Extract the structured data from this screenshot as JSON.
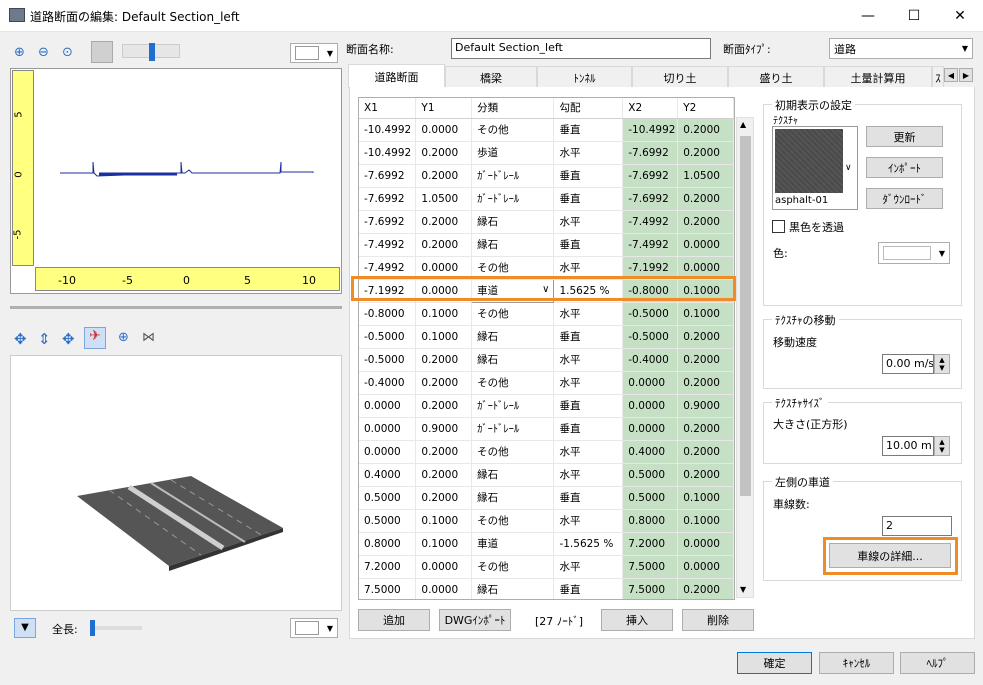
{
  "window": {
    "title": "道路断面の編集: Default Section_left",
    "minimize": "—",
    "maximize": "☐",
    "close": "✕"
  },
  "left": {
    "ruler_y_labels": [
      "5",
      "0",
      "-5"
    ],
    "ruler_x_labels": [
      "-10",
      "-5",
      "0",
      "5",
      "10"
    ],
    "length_label": "全長:"
  },
  "header": {
    "name_label": "断面名称:",
    "name_value": "Default Section_left",
    "type_label": "断面ﾀｲﾌﾟ:",
    "type_value": "道路"
  },
  "tabs": [
    "道路断面",
    "橋梁",
    "ﾄﾝﾈﾙ",
    "切り土",
    "盛り土",
    "土量計算用",
    "ｽ"
  ],
  "grid": {
    "columns": [
      "X1",
      "Y1",
      "分類",
      "勾配",
      "X2",
      "Y2"
    ],
    "rows": [
      [
        "-10.4992",
        "0.0000",
        "その他",
        "垂直",
        "-10.4992",
        "0.2000"
      ],
      [
        "-10.4992",
        "0.2000",
        "歩道",
        "水平",
        "-7.6992",
        "0.2000"
      ],
      [
        "-7.6992",
        "0.2000",
        "ｶﾞｰﾄﾞﾚｰﾙ",
        "垂直",
        "-7.6992",
        "1.0500"
      ],
      [
        "-7.6992",
        "1.0500",
        "ｶﾞｰﾄﾞﾚｰﾙ",
        "垂直",
        "-7.6992",
        "0.2000"
      ],
      [
        "-7.6992",
        "0.2000",
        "縁石",
        "水平",
        "-7.4992",
        "0.2000"
      ],
      [
        "-7.4992",
        "0.2000",
        "縁石",
        "垂直",
        "-7.4992",
        "0.0000"
      ],
      [
        "-7.4992",
        "0.0000",
        "その他",
        "水平",
        "-7.1992",
        "0.0000"
      ],
      [
        "-7.1992",
        "0.0000",
        "車道",
        "1.5625 %",
        "-0.8000",
        "0.1000"
      ],
      [
        "-0.8000",
        "0.1000",
        "その他",
        "水平",
        "-0.5000",
        "0.1000"
      ],
      [
        "-0.5000",
        "0.1000",
        "縁石",
        "垂直",
        "-0.5000",
        "0.2000"
      ],
      [
        "-0.5000",
        "0.2000",
        "縁石",
        "水平",
        "-0.4000",
        "0.2000"
      ],
      [
        "-0.4000",
        "0.2000",
        "その他",
        "水平",
        "0.0000",
        "0.2000"
      ],
      [
        "0.0000",
        "0.2000",
        "ｶﾞｰﾄﾞﾚｰﾙ",
        "垂直",
        "0.0000",
        "0.9000"
      ],
      [
        "0.0000",
        "0.9000",
        "ｶﾞｰﾄﾞﾚｰﾙ",
        "垂直",
        "0.0000",
        "0.2000"
      ],
      [
        "0.0000",
        "0.2000",
        "その他",
        "水平",
        "0.4000",
        "0.2000"
      ],
      [
        "0.4000",
        "0.2000",
        "縁石",
        "水平",
        "0.5000",
        "0.2000"
      ],
      [
        "0.5000",
        "0.2000",
        "縁石",
        "垂直",
        "0.5000",
        "0.1000"
      ],
      [
        "0.5000",
        "0.1000",
        "その他",
        "水平",
        "0.8000",
        "0.1000"
      ],
      [
        "0.8000",
        "0.1000",
        "車道",
        "-1.5625 %",
        "7.2000",
        "0.0000"
      ],
      [
        "7.2000",
        "0.0000",
        "その他",
        "水平",
        "7.5000",
        "0.0000"
      ],
      [
        "7.5000",
        "0.0000",
        "縁石",
        "垂直",
        "7.5000",
        "0.2000"
      ]
    ],
    "selected_row": 7
  },
  "grid_buttons": {
    "add": "追加",
    "dwg": "DWGｲﾝﾎﾟｰﾄ",
    "nodes": "[27 ﾉｰﾄﾞ]",
    "insert": "挿入",
    "delete": "削除"
  },
  "initial": {
    "group": "初期表示の設定",
    "texture_label": "ﾃｸｽﾁｬ",
    "texture_name": "asphalt-01",
    "update": "更新",
    "import": "ｲﾝﾎﾟｰﾄ",
    "download": "ﾀﾞｳﾝﾛｰﾄﾞ",
    "transparent": "黒色を透過",
    "color_label": "色:"
  },
  "move": {
    "group": "ﾃｸｽﾁｬの移動",
    "speed_label": "移動速度",
    "speed_value": "0.00 m/s"
  },
  "size": {
    "group": "ﾃｸｽﾁｬｻｲｽﾞ",
    "size_label": "大きさ(正方形)",
    "size_value": "10.00  m"
  },
  "lanes": {
    "group": "左側の車道",
    "count_label": "車線数:",
    "count_value": "2",
    "detail": "車線の詳細..."
  },
  "footer": {
    "ok": "確定",
    "cancel": "ｷｬﾝｾﾙ",
    "help": "ﾍﾙﾌﾟ"
  }
}
